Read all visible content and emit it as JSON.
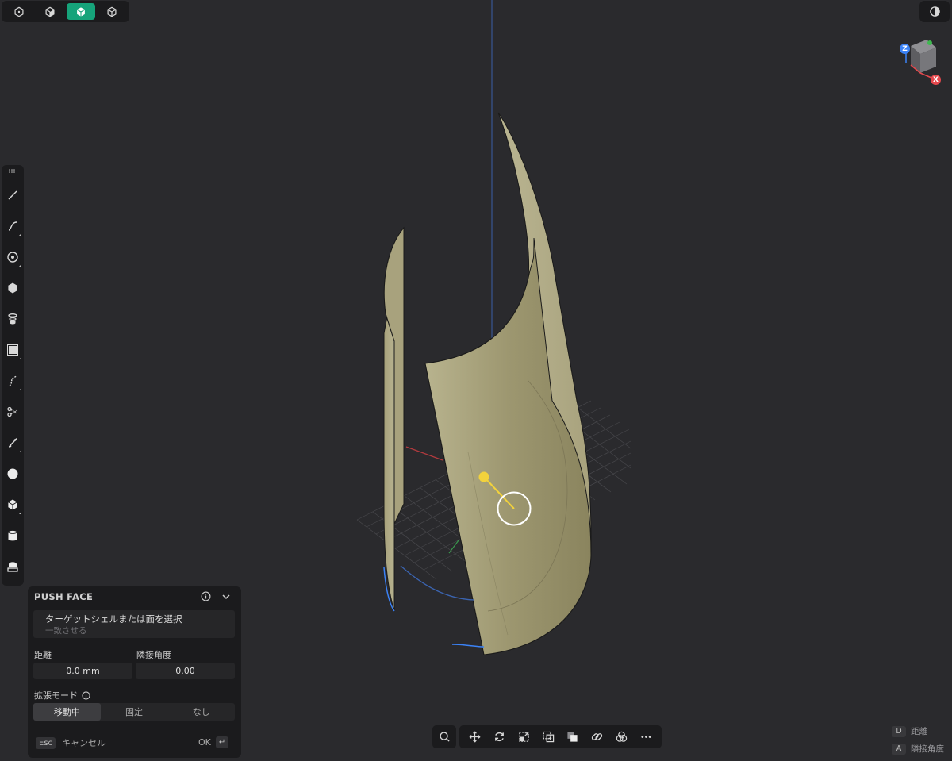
{
  "view_toolbar": {
    "buttons": [
      {
        "icon": "hexagon-outline-icon",
        "active": false
      },
      {
        "icon": "cube-half-icon",
        "active": false
      },
      {
        "icon": "cube-solid-icon",
        "active": true
      },
      {
        "icon": "cube-wireframe-icon",
        "active": false
      }
    ]
  },
  "theme_toggle": {
    "icon": "contrast-icon"
  },
  "view_cube": {
    "z_label": "Z",
    "x_label": "X"
  },
  "tools": [
    {
      "name": "line-tool",
      "icon": "line-icon",
      "has_submenu": false
    },
    {
      "name": "curve-tool",
      "icon": "curve-icon",
      "has_submenu": true
    },
    {
      "name": "circle-tool",
      "icon": "circle-target-icon",
      "has_submenu": true
    },
    {
      "name": "polygon-tool",
      "icon": "hexagon-icon",
      "has_submenu": false
    },
    {
      "name": "loft-tool",
      "icon": "loft-icon",
      "has_submenu": false
    },
    {
      "name": "rectangle-tool",
      "icon": "square-frame-icon",
      "has_submenu": true
    },
    {
      "name": "spline-tool",
      "icon": "spline-icon",
      "has_submenu": true
    },
    {
      "name": "trim-tool",
      "icon": "scissors-icon",
      "has_submenu": false
    },
    {
      "name": "sweep-tool",
      "icon": "sweep-icon",
      "has_submenu": true
    },
    {
      "name": "sphere-tool",
      "icon": "sphere-icon",
      "has_submenu": false
    },
    {
      "name": "box-tool",
      "icon": "box-icon",
      "has_submenu": true
    },
    {
      "name": "cylinder-tool",
      "icon": "cylinder-icon",
      "has_submenu": false
    },
    {
      "name": "text-tool",
      "icon": "stamp-icon",
      "has_submenu": false
    }
  ],
  "push_face": {
    "title": "PUSH FACE",
    "target_prompt": "ターゲットシェルまたは面を選択",
    "target_hint": "一致させる",
    "distance_label": "距離",
    "distance_value": "0.0 mm",
    "angle_label": "隣接角度",
    "angle_value": "0.00",
    "mode_label": "拡張モード",
    "modes": [
      "移動中",
      "固定",
      "なし"
    ],
    "active_mode": 0,
    "cancel_key": "Esc",
    "cancel_label": "キャンセル",
    "ok_label": "OK",
    "ok_key": "↵"
  },
  "bottom_toolbar": {
    "left": {
      "icon": "search-icon"
    },
    "actions": [
      {
        "name": "move-action",
        "icon": "move-arrows-icon"
      },
      {
        "name": "rotate-action",
        "icon": "rotate-icon"
      },
      {
        "name": "scale-action",
        "icon": "scale-icon"
      },
      {
        "name": "copy-action",
        "icon": "copy-icon"
      },
      {
        "name": "boolean-action",
        "icon": "overlap-squares-icon"
      },
      {
        "name": "link-action",
        "icon": "link-icon"
      },
      {
        "name": "venn-action",
        "icon": "venn-icon"
      },
      {
        "name": "more-action",
        "icon": "ellipsis-icon"
      }
    ]
  },
  "shortcut_hints": [
    {
      "key": "D",
      "label": "距離"
    },
    {
      "key": "A",
      "label": "隣接角度"
    }
  ],
  "colors": {
    "background": "#2a2a2d",
    "panel": "#1b1b1d",
    "accent_green": "#16a37a",
    "surface": "#a8a27d",
    "gizmo_yellow": "#f2d23c",
    "axis_red": "#e5484d",
    "axis_blue": "#3b82f6",
    "axis_green": "#3fb950"
  }
}
